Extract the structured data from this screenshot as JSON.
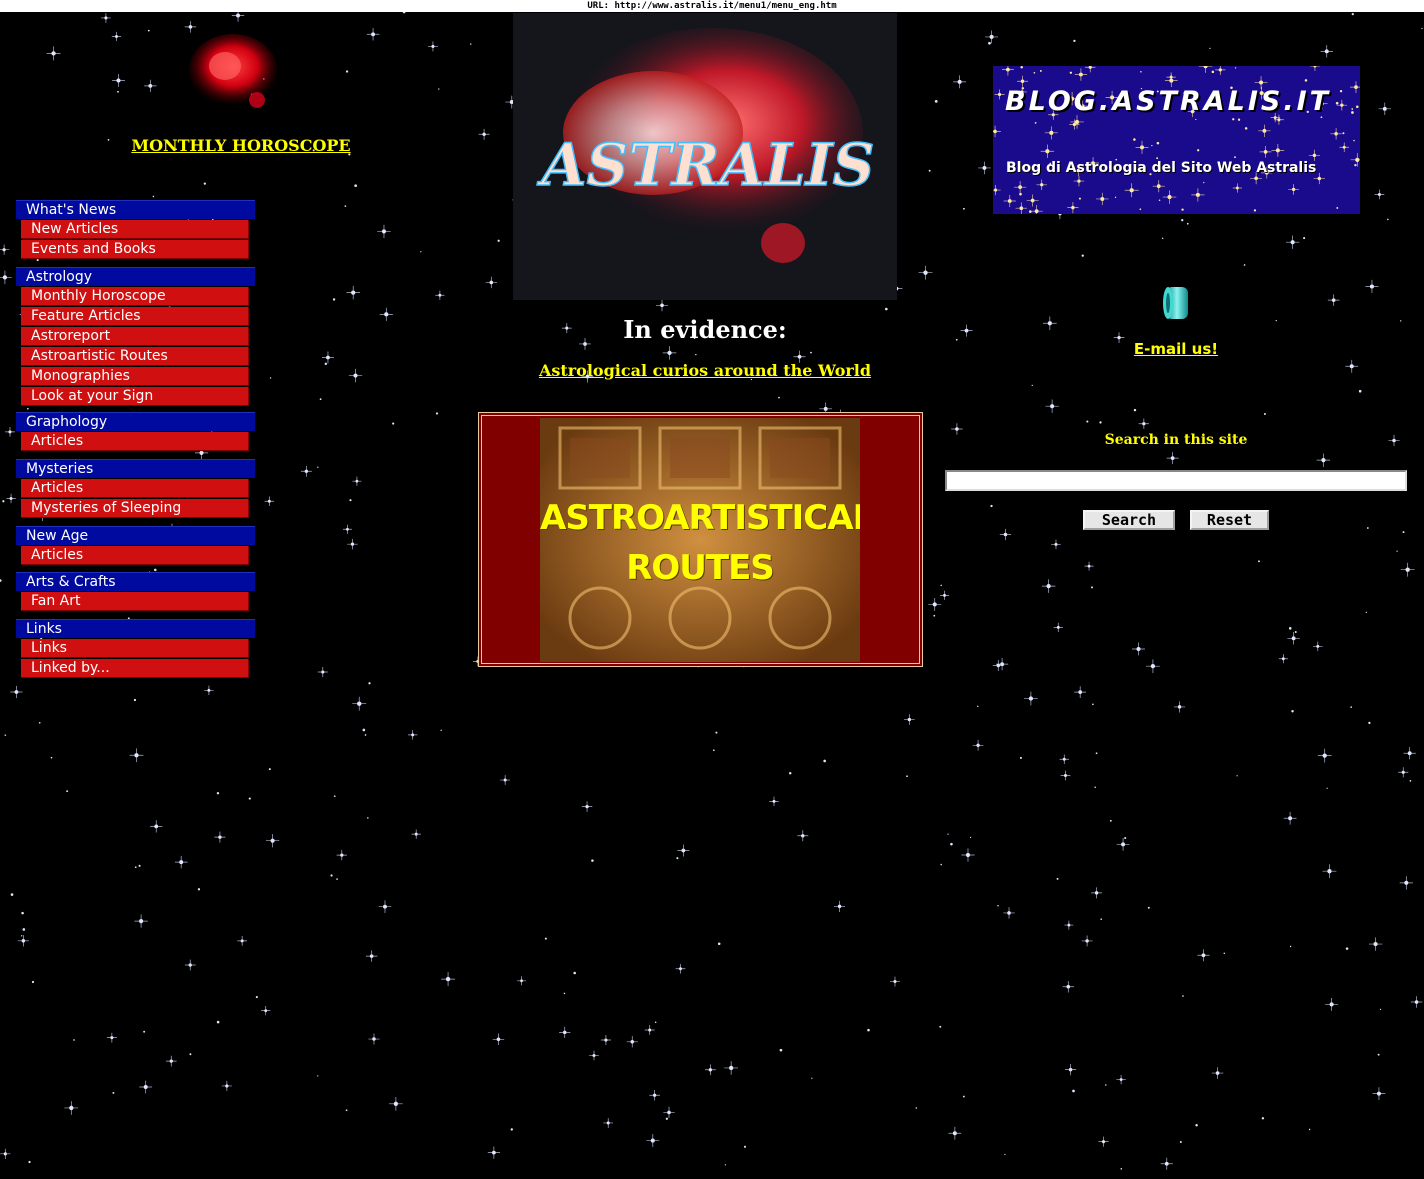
{
  "browser": {
    "url_label": "URL: http://www.astralis.it/menu1/menu_eng.htm"
  },
  "colors": {
    "background": "#000000",
    "link": "#ffff00",
    "menu_header": "#000a9e",
    "menu_item": "#d01010",
    "banner_frame": "#800000"
  },
  "left": {
    "monthly_link": "MONTHLY HOROSCOPE",
    "menu": [
      {
        "header": "What's News",
        "items": [
          "New Articles",
          "Events and Books"
        ]
      },
      {
        "header": "Astrology",
        "items": [
          "Monthly Horoscope",
          "Feature Articles",
          "Astroreport",
          "Astroartistic Routes",
          "Monographies",
          "Look at your Sign"
        ]
      },
      {
        "header": "Graphology",
        "items": [
          "Articles"
        ]
      },
      {
        "header": "Mysteries",
        "items": [
          "Articles",
          "Mysteries of Sleeping"
        ]
      },
      {
        "header": "New Age",
        "items": [
          "Articles"
        ]
      },
      {
        "header": "Arts & Crafts",
        "items": [
          "Fan Art"
        ]
      },
      {
        "header": "Links",
        "items": [
          "Links",
          "Linked by..."
        ]
      }
    ]
  },
  "center": {
    "logo_text": "ASTRALIS",
    "evidence_title": "In evidence:",
    "curios_link": "Astrological curios around the World",
    "banner_line1": "ASTROARTISTICAL",
    "banner_line2": "ROUTES"
  },
  "right": {
    "blog_title": "BLOG.ASTRALIS.IT",
    "blog_subtitle": "Blog di Astrologia del Sito Web Astralis",
    "email_link": "E-mail us!",
    "search_label": "Search in this site",
    "search_value": "",
    "search_button": "Search",
    "reset_button": "Reset"
  }
}
